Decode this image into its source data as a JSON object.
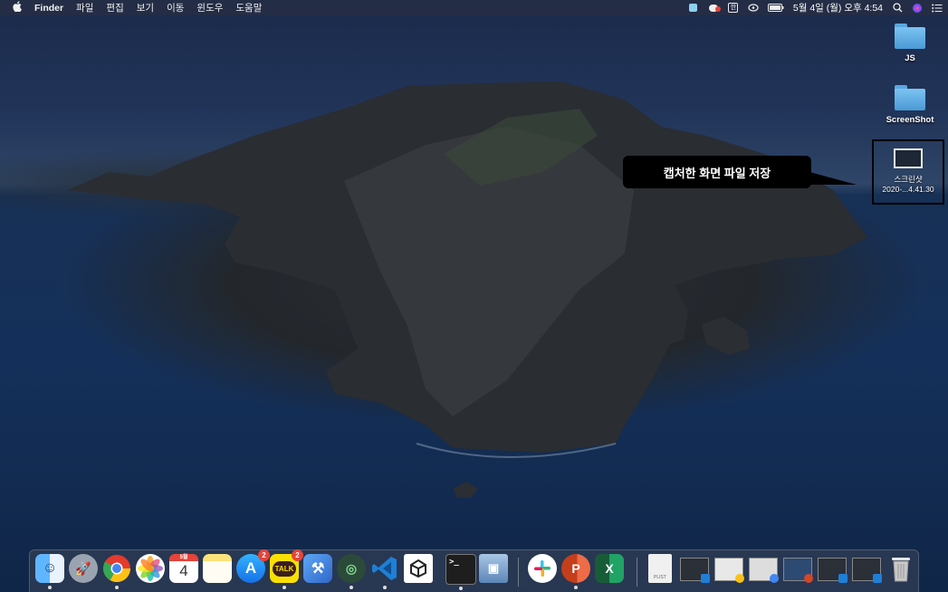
{
  "menubar": {
    "apple": "",
    "app_name": "Finder",
    "menus": [
      "파일",
      "편집",
      "보기",
      "이동",
      "윈도우",
      "도움말"
    ],
    "datetime": "5월 4일 (월) 오후 4:54"
  },
  "desktop": {
    "items": [
      {
        "label": "JS",
        "kind": "folder"
      },
      {
        "label": "ScreenShot",
        "kind": "folder"
      },
      {
        "label_line1": "스크린샷",
        "label_line2": "2020-...4.41.30",
        "kind": "image"
      }
    ]
  },
  "callout": {
    "text": "캡처한 화면 파일 저장"
  },
  "dock": {
    "apps": [
      {
        "name": "Finder",
        "icon": "finder-icon",
        "color": "#3b8df0"
      },
      {
        "name": "Launchpad",
        "icon": "rocket-icon",
        "color": "#9aa3b0"
      },
      {
        "name": "Chrome",
        "icon": "chrome-icon",
        "color": "#ffffff"
      },
      {
        "name": "Photos",
        "icon": "photos-icon",
        "color": "#ffffff"
      },
      {
        "name": "Calendar",
        "icon": "calendar-icon",
        "color": "#ffffff",
        "month": "5월",
        "day": "4"
      },
      {
        "name": "Notes",
        "icon": "notes-icon",
        "color": "#fbe27a"
      },
      {
        "name": "App Store",
        "icon": "appstore-icon",
        "color": "#1e8cf0",
        "badge": "2"
      },
      {
        "name": "KakaoTalk",
        "icon": "kakaotalk-icon",
        "color": "#f9e000",
        "badge": "2",
        "text": "TALK"
      },
      {
        "name": "Xcode",
        "icon": "xcode-icon",
        "color": "#3a7ad8"
      },
      {
        "name": "Android Studio",
        "icon": "android-studio-icon",
        "color": "#3c9a5a"
      },
      {
        "name": "VS Code",
        "icon": "vscode-icon",
        "color": "#1f7fd6"
      },
      {
        "name": "Unity",
        "icon": "unity-icon",
        "color": "#ffffff"
      },
      {
        "name": "Terminal",
        "icon": "terminal-icon",
        "color": "#1e1e1e"
      },
      {
        "name": "Preview",
        "icon": "preview-icon",
        "color": "#7aa7d0"
      },
      {
        "name": "Slack",
        "icon": "slack-icon",
        "color": "#ffffff"
      },
      {
        "name": "PowerPoint",
        "icon": "powerpoint-icon",
        "color": "#d24726"
      },
      {
        "name": "Excel",
        "icon": "excel-icon",
        "color": "#1f7244"
      }
    ],
    "file_label": "PLIST",
    "minimized_windows": 6,
    "trash": {
      "name": "Trash",
      "icon": "trash-icon"
    }
  }
}
